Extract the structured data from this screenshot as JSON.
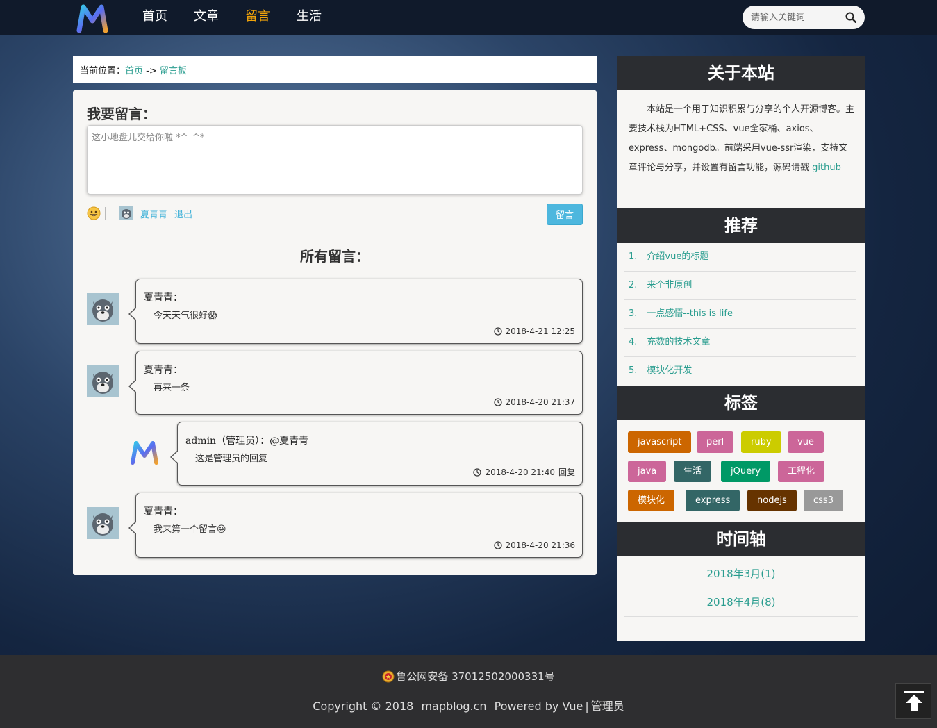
{
  "nav": {
    "items": [
      {
        "label": "首页"
      },
      {
        "label": "文章"
      },
      {
        "label": "留言"
      },
      {
        "label": "生活"
      }
    ],
    "active_index": 2
  },
  "search": {
    "placeholder": "请输入关键词",
    "icon": "search-icon"
  },
  "breadcrumb": {
    "prefix": "当前位置：",
    "home": "首页",
    "arrow": "->",
    "current": "留言板"
  },
  "leave_form": {
    "title": "我要留言：",
    "placeholder": "这小地盘儿交给你啦 *^_^*",
    "user": "夏青青",
    "logout": "退出",
    "submit": "留言"
  },
  "comments": {
    "title": "所有留言：",
    "items": [
      {
        "author": "夏青青：",
        "text": "今天天气很好😱",
        "time": "2018-4-21 12:25",
        "reply": ""
      },
      {
        "author": "夏青青：",
        "text": "再来一条",
        "time": "2018-4-20 21:37",
        "reply": ""
      },
      {
        "author": "admin（管理员）：@夏青青",
        "text": "这是管理员的回复",
        "time": "2018-4-20 21:40",
        "reply": "回复"
      },
      {
        "author": "夏青青：",
        "text": "我来第一个留言😜",
        "time": "2018-4-20 21:36",
        "reply": ""
      }
    ]
  },
  "sidebar": {
    "about": {
      "title": "关于本站",
      "text": "本站是一个用于知识积累与分享的个人开源博客。主要技术栈为HTML+CSS、vue全家桶、axios、express、mongodb。前端采用vue-ssr渲染，支持文章评论与分享，并设置有留言功能，源码请戳 ",
      "link": "github"
    },
    "recommend": {
      "title": "推荐",
      "items": [
        {
          "num": "1.",
          "label": "介绍vue的标题"
        },
        {
          "num": "2.",
          "label": "来个非原创"
        },
        {
          "num": "3.",
          "label": "一点感悟--this is life"
        },
        {
          "num": "4.",
          "label": "充数的技术文章"
        },
        {
          "num": "5.",
          "label": "模块化开发"
        }
      ]
    },
    "tags": {
      "title": "标签",
      "items": [
        {
          "label": "javascript",
          "color": "#cc6600"
        },
        {
          "label": "perl",
          "color": "#cc6699"
        },
        {
          "label": "ruby",
          "color": "#cccc00"
        },
        {
          "label": "vue",
          "color": "#cc6699"
        },
        {
          "label": "java",
          "color": "#cc6699"
        },
        {
          "label": "生活",
          "color": "#336666"
        },
        {
          "label": "jQuery",
          "color": "#009966"
        },
        {
          "label": "工程化",
          "color": "#cc6699"
        },
        {
          "label": "模块化",
          "color": "#cc6600"
        },
        {
          "label": "express",
          "color": "#336666"
        },
        {
          "label": "nodejs",
          "color": "#663300"
        },
        {
          "label": "css3",
          "color": "#999999"
        }
      ]
    },
    "timeline": {
      "title": "时间轴",
      "items": [
        {
          "label": "2018年3月(1)"
        },
        {
          "label": "2018年4月(8)"
        }
      ]
    }
  },
  "footer": {
    "beian": "鲁公网安备 37012502000331号",
    "copyright": "Copyright © 2018",
    "site": "mapblog.cn",
    "powered": "Powered by Vue",
    "divider": "|",
    "admin": "管理员"
  },
  "colors": {
    "accent": "#f0a30a",
    "link": "#2a9d8f",
    "button": "#4db7de",
    "header": "#2b2d31"
  }
}
